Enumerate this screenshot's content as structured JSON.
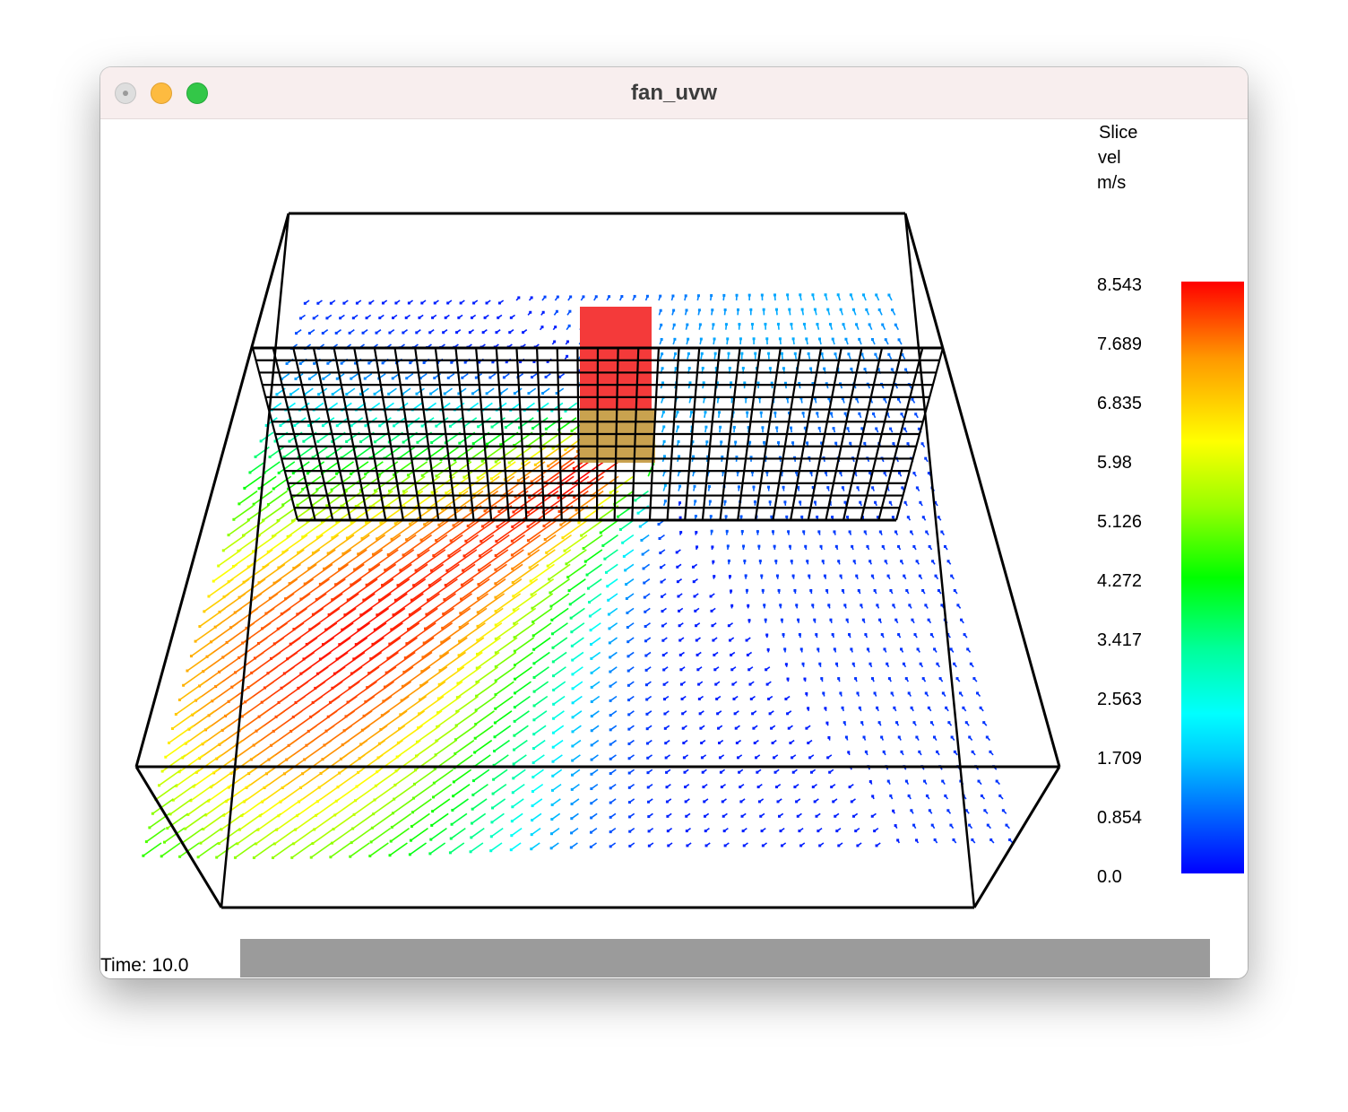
{
  "window": {
    "title": "fan_uvw"
  },
  "legend": {
    "line1": "Slice",
    "line2": "vel",
    "line3": "m/s",
    "ticks": [
      "8.543",
      "7.689",
      "6.835",
      "5.98",
      "5.126",
      "4.272",
      "3.417",
      "2.563",
      "1.709",
      "0.854",
      "0.0"
    ],
    "colors": [
      "#0000ff",
      "#00ffff",
      "#00ff00",
      "#ffff00",
      "#ff0000"
    ]
  },
  "footer": {
    "time_label": "Time: 10.0"
  },
  "scene": {
    "obstruction_top_color": "#f43a3a",
    "obstruction_bottom_color": "#c9a24f"
  }
}
